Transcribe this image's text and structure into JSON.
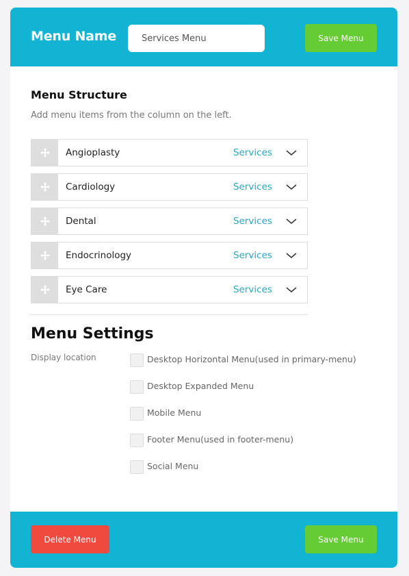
{
  "header": {
    "menu_name_label": "Menu Name",
    "menu_name_value": "Services Menu",
    "save_label": "Save Menu"
  },
  "structure": {
    "title": "Menu Structure",
    "description": "Add menu items from the column on the left.",
    "items": [
      {
        "label": "Angioplasty",
        "type": "Services",
        "icon": "chevron-down-icon"
      },
      {
        "label": "Cardiology",
        "type": "Services",
        "icon": "chevron-down-icon"
      },
      {
        "label": "Dental",
        "type": "Services",
        "icon": "chevron-down-icon"
      },
      {
        "label": "Endocrinology",
        "type": "Services",
        "icon": "chevron-down-icon"
      },
      {
        "label": "Eye Care",
        "type": "Services",
        "icon": "chevron-down-icon"
      }
    ]
  },
  "settings": {
    "title": "Menu Settings",
    "display_location_label": "Display location",
    "locations": [
      {
        "label": "Desktop Horizontal Menu(used in primary-menu)",
        "checked": false
      },
      {
        "label": "Desktop Expanded Menu",
        "checked": false
      },
      {
        "label": "Mobile Menu",
        "checked": false
      },
      {
        "label": "Footer Menu(used in footer-menu)",
        "checked": false
      },
      {
        "label": "Social Menu",
        "checked": false
      }
    ]
  },
  "footer": {
    "delete_label": "Delete Menu",
    "save_label": "Save Menu"
  },
  "colors": {
    "accent": "#13b4d3",
    "save": "#66cc33",
    "delete": "#f04a3f",
    "link": "#2aa6c4"
  }
}
